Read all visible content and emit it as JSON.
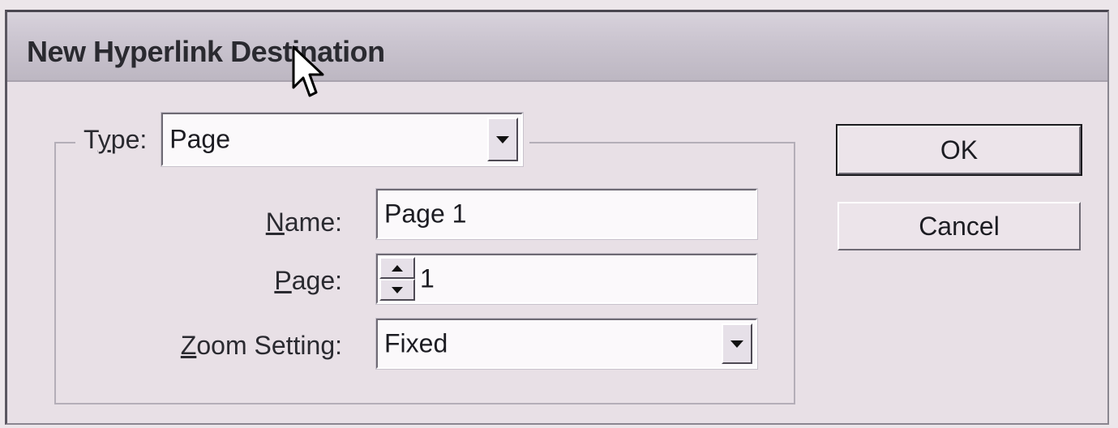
{
  "dialog": {
    "title": "New Hyperlink Destination"
  },
  "type": {
    "label_pre": "T",
    "label_u": "y",
    "label_post": "pe:",
    "value": "Page"
  },
  "name": {
    "label_u": "N",
    "label_post": "ame:",
    "value": "Page 1"
  },
  "page": {
    "label_u": "P",
    "label_post": "age:",
    "value": "1"
  },
  "zoom": {
    "label_u": "Z",
    "label_post": "oom Setting:",
    "value": "Fixed"
  },
  "buttons": {
    "ok": "OK",
    "cancel": "Cancel"
  },
  "icons": {
    "dropdown": "chevron-down-icon",
    "step_up": "arrow-up-icon",
    "step_down": "arrow-down-icon",
    "cursor": "mouse-pointer-icon"
  }
}
